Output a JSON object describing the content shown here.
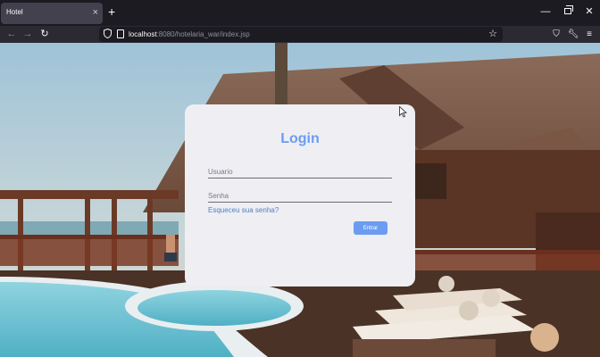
{
  "browser": {
    "tab_title": "Hotel",
    "tab_close": "×",
    "new_tab": "+",
    "url_host": "localhost",
    "url_path": ":8080/hotelaria_war/index.jsp",
    "icons": [
      "back-arrow-icon",
      "forward-arrow-icon",
      "reload-icon",
      "shield-icon",
      "page-icon",
      "star-icon",
      "pocket-icon",
      "wrench-icon",
      "menu-icon",
      "minimize-icon",
      "restore-icon",
      "close-icon"
    ]
  },
  "login": {
    "title": "Login",
    "username_placeholder": "Usuario",
    "password_placeholder": "Senha",
    "forgot_link": "Esqueceu sua senha?",
    "submit_label": "Entrar",
    "accent_color": "#6b9cf2"
  }
}
